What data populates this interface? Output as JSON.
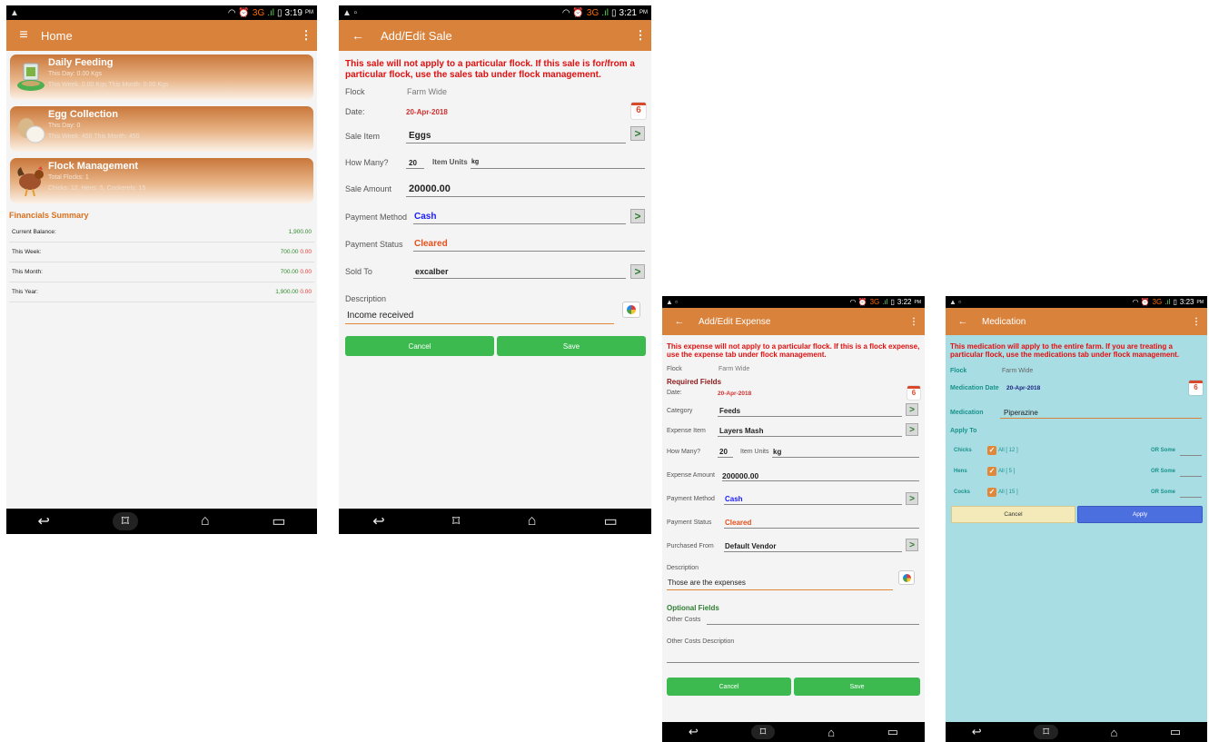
{
  "home": {
    "status": {
      "left_icon": "▲",
      "right_icons": "◠ ⏰",
      "net": "3G",
      "signal": ".ıl",
      "battery": "▯",
      "time": "3:19",
      "ampm": "PM"
    },
    "title": "Home",
    "menu_icon": "≡",
    "more_icon": "⋮",
    "tiles": [
      {
        "title": "Daily Feeding",
        "line1": "This Day: 0.00 Kgs",
        "line2": "This Week: 0.00 Kgs  This Month: 0.00 Kgs"
      },
      {
        "title": "Egg Collection",
        "line1": "This Day: 0",
        "line2": "This Week: 450  This Month: 450"
      },
      {
        "title": "Flock Management",
        "line1": "Total Flocks: 1",
        "line2": "Chicks: 12, Hens: 5, Cockerels: 15"
      }
    ],
    "financials_title": "Financials Summary",
    "financials": [
      {
        "label": "Current Balance:",
        "green": "1,900.00",
        "red": ""
      },
      {
        "label": "This Week:",
        "green": "700.00",
        "red": "0.00"
      },
      {
        "label": "This Month:",
        "green": "700.00",
        "red": "0.00"
      },
      {
        "label": "This Year:",
        "green": "1,900.00",
        "red": "0.00"
      }
    ]
  },
  "sale": {
    "status": {
      "left_icon": "▲ ▫",
      "right_icons": "◠ ⏰",
      "net": "3G",
      "signal": ".ıl",
      "battery": "▯",
      "time": "3:21",
      "ampm": "PM"
    },
    "title": "Add/Edit Sale",
    "back_icon": "←",
    "more_icon": "⋮",
    "warning": "This sale will not apply to a particular flock. If this sale is for/from a particular flock, use the sales tab under flock management.",
    "flock_label": "Flock",
    "flock_value": "Farm Wide",
    "date_label": "Date:",
    "date_value": "20-Apr-2018",
    "calendar_day": "6",
    "sale_item_label": "Sale Item",
    "sale_item_value": "Eggs",
    "how_many_label": "How Many?",
    "how_many_value": "20",
    "item_units_label": "Item Units",
    "item_units_value": "kg",
    "sale_amount_label": "Sale Amount",
    "sale_amount_value": "20000.00",
    "payment_method_label": "Payment Method",
    "payment_method_value": "Cash",
    "payment_status_label": "Payment Status",
    "payment_status_value": "Cleared",
    "sold_to_label": "Sold To",
    "sold_to_value": "excalber",
    "description_label": "Description",
    "description_value": "Income received",
    "arrow": ">",
    "cancel": "Cancel",
    "save": "Save",
    "colors": {
      "link": "#1a1aff",
      "status": "#e8501a",
      "date": "#d32f2f"
    }
  },
  "expense": {
    "status": {
      "left_icon": "▲ ▫",
      "right_icons": "◠ ⏰",
      "net": "3G",
      "signal": ".ıl",
      "battery": "▯",
      "time": "3:22",
      "ampm": "PM"
    },
    "title": "Add/Edit Expense",
    "back_icon": "←",
    "more_icon": "⋮",
    "warning": "This expense will not apply to a particular flock. If this is a flock expense, use the expense tab under flock management.",
    "flock_label": "Flock",
    "flock_value": "Farm Wide",
    "required_title": "Required Fields",
    "date_label": "Date:",
    "date_value": "20-Apr-2018",
    "calendar_day": "6",
    "category_label": "Category",
    "category_value": "Feeds",
    "expense_item_label": "Expense Item",
    "expense_item_value": "Layers Mash",
    "how_many_label": "How Many?",
    "how_many_value": "20",
    "item_units_label": "Item Units",
    "item_units_value": "kg",
    "amount_label": "Expense Amount",
    "amount_value": "200000.00",
    "payment_method_label": "Payment Method",
    "payment_method_value": "Cash",
    "payment_status_label": "Payment Status",
    "payment_status_value": "Cleared",
    "purchased_from_label": "Purchased From",
    "purchased_from_value": "Default Vendor",
    "description_label": "Description",
    "description_value": "Those are the expenses",
    "optional_title": "Optional Fields",
    "other_costs_label": "Other Costs",
    "other_costs_desc_label": "Other Costs Description",
    "arrow": ">",
    "cancel": "Cancel",
    "save": "Save"
  },
  "medication": {
    "status": {
      "left_icon": "▲ ▫",
      "right_icons": "◠ ⏰",
      "net": "3G",
      "signal": ".ıl",
      "battery": "▯",
      "time": "3:23",
      "ampm": "PM"
    },
    "title": "Medication",
    "back_icon": "←",
    "more_icon": "⋮",
    "warning": "This medication will apply to the entire farm. If you are treating a particular flock, use the medications tab under flock management.",
    "flock_label": "Flock",
    "flock_value": "Farm Wide",
    "date_label": "Medication Date",
    "date_value": "20-Apr-2018",
    "calendar_day": "6",
    "medication_label": "Medication",
    "medication_value": "Piperazine",
    "apply_to": "Apply To",
    "rows": [
      {
        "label": "Chicks",
        "all": "All [ 12 ]",
        "some": "OR Some"
      },
      {
        "label": "Hens",
        "all": "All [ 5 ]",
        "some": "OR Some"
      },
      {
        "label": "Cocks",
        "all": "All [ 15 ]",
        "some": "OR Some"
      }
    ],
    "check": "✓",
    "cancel": "Cancel",
    "apply": "Apply"
  },
  "nav": {
    "back": "↩",
    "recents_alt": "⌑",
    "home": "⌂",
    "recents": "▭"
  }
}
